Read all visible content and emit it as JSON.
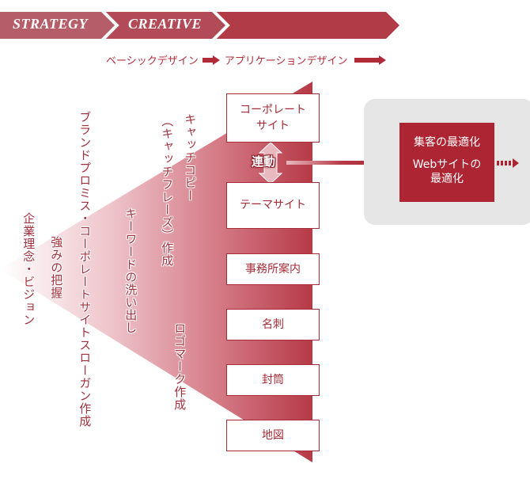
{
  "header": {
    "phases": [
      {
        "label": "STRATEGY",
        "color": "#b55a66"
      },
      {
        "label": "CREATIVE",
        "color": "#b24a56"
      },
      {
        "label": "",
        "color": "#b13c48"
      }
    ]
  },
  "subheader": {
    "basic_design": "ベーシックデザイン",
    "application_design": "アプリケーションデザイン",
    "arrow_color": "#b02a37"
  },
  "funnel_labels": [
    {
      "text": "企業理念・ビジョン"
    },
    {
      "text": "強みの把握"
    },
    {
      "text": "ブランドプロミス・コーポレートサイトスローガン作成"
    },
    {
      "text": "キーワードの洗い出し"
    },
    {
      "text": "（キャッチフレーズ）作成"
    },
    {
      "text": "キャッチコピー"
    },
    {
      "text": "ロゴマーク作成"
    }
  ],
  "outputs": [
    {
      "label": "コーポレート\nサイト"
    },
    {
      "label": "テーマサイト"
    },
    {
      "label": "事務所案内"
    },
    {
      "label": "名刺"
    },
    {
      "label": "封筒"
    },
    {
      "label": "地図"
    }
  ],
  "link_badge": "連動",
  "result": {
    "line1": "集客の最適化",
    "line2": "Webサイトの",
    "line3": "最適化"
  },
  "colors": {
    "accent": "#ad2532",
    "panel_bg": "#e6e6e6"
  }
}
